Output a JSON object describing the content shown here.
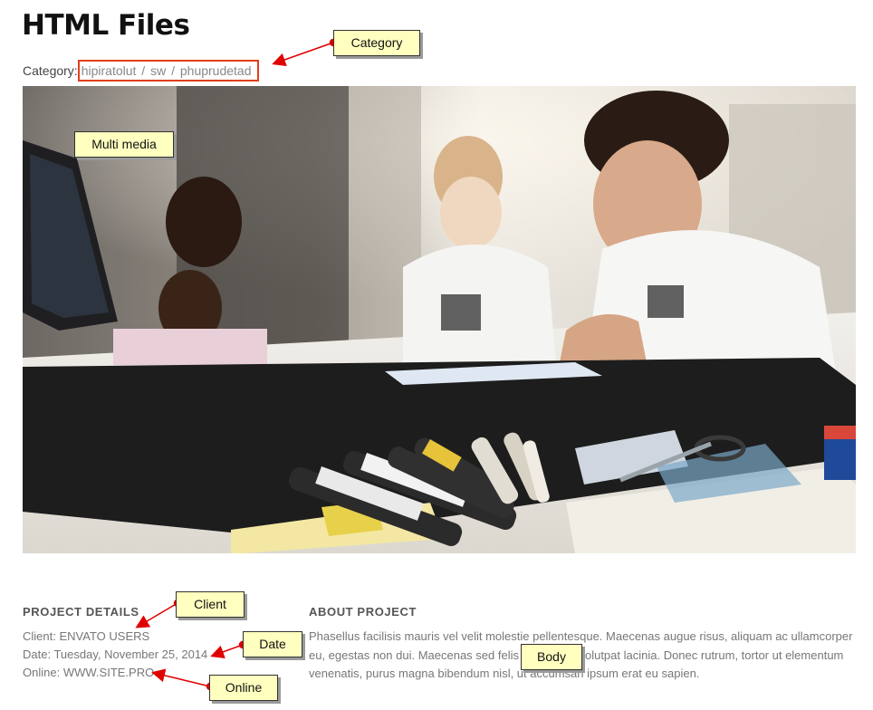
{
  "page": {
    "title": "HTML Files"
  },
  "category": {
    "label": "Category:",
    "links": [
      "hipiratolut",
      "sw",
      "phuprudetad"
    ],
    "separator": "/"
  },
  "details": {
    "heading": "PROJECT DETAILS",
    "client_label": "Client:",
    "client_value": "ENVATO USERS",
    "date_label": "Date:",
    "date_value": "Tuesday, November 25, 2014",
    "online_label": "Online:",
    "online_value": "WWW.SITE.PRO"
  },
  "about": {
    "heading": "ABOUT PROJECT",
    "body": "Phasellus facilisis mauris vel velit molestie pellentesque. Maecenas augue risus, aliquam ac ullamcorper eu, egestas non dui. Maecenas sed felis lacus eget volutpat lacinia. Donec rutrum, tortor ut elementum venenatis, purus magna bibendum nisl, ut accumsan ipsum erat eu sapien."
  },
  "annotations": {
    "category": "Category",
    "multimedia": "Multi media",
    "client": "Client",
    "date": "Date",
    "online": "Online",
    "body": "Body"
  },
  "colors": {
    "highlight_border": "#e0401a",
    "callout_bg": "#ffffc0",
    "arrow": "#e00000"
  }
}
